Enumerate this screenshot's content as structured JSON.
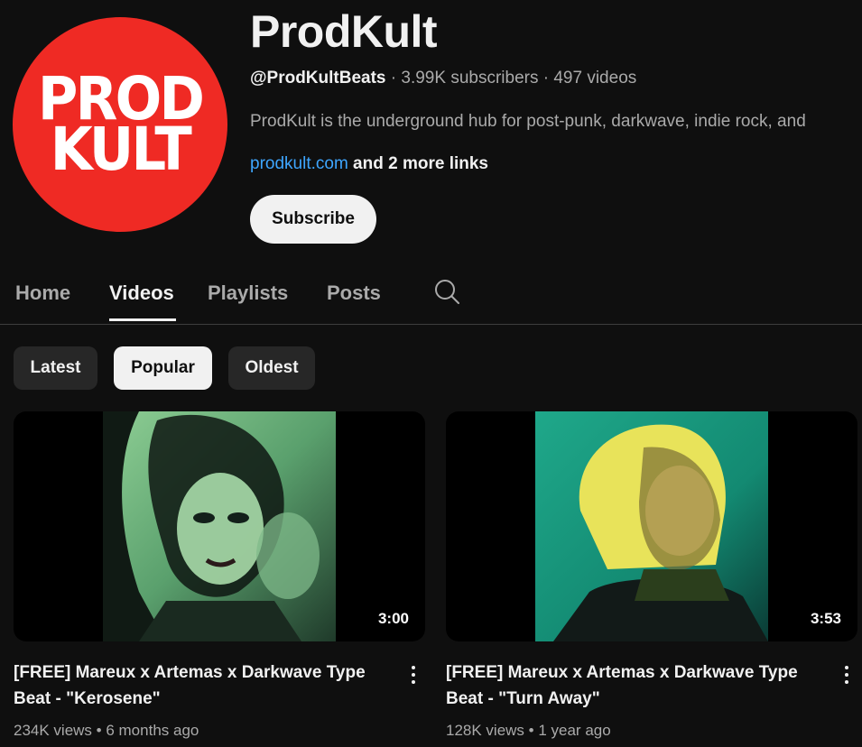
{
  "channel": {
    "logo_line1": "PROD",
    "logo_line2": "KULT",
    "logo_mark": "®",
    "name": "ProdKult",
    "handle": "@ProdKultBeats",
    "separator": " · ",
    "subscribers": "3.99K subscribers",
    "videos_count": "497 videos",
    "description": "ProdKult is the underground hub for post-punk, darkwave, indie rock, and",
    "description_more": "›",
    "link": "prodkult.com",
    "more_links": " and 2 more links",
    "subscribe_label": "Subscribe",
    "brand_color": "#ef2a24"
  },
  "tabs": [
    {
      "label": "Home",
      "active": false
    },
    {
      "label": "Videos",
      "active": true
    },
    {
      "label": "Playlists",
      "active": false
    },
    {
      "label": "Posts",
      "active": false
    }
  ],
  "search_icon": "search-icon",
  "chips": [
    {
      "label": "Latest",
      "active": false
    },
    {
      "label": "Popular",
      "active": true
    },
    {
      "label": "Oldest",
      "active": false
    }
  ],
  "videos": [
    {
      "title": "[FREE] Mareux x Artemas x Darkwave Type Beat - \"Kerosene\"",
      "duration": "3:00",
      "views": "234K views",
      "age": "6 months ago",
      "meta_sep": " • "
    },
    {
      "title": "[FREE] Mareux x Artemas x Darkwave Type Beat - \"Turn Away\"",
      "duration": "3:53",
      "views": "128K views",
      "age": "1 year ago",
      "meta_sep": " • "
    }
  ],
  "colors": {
    "background": "#0f0f0f",
    "text_primary": "#f1f1f1",
    "text_secondary": "#aaaaaa",
    "link": "#3ea6ff",
    "chip_bg": "#272727"
  }
}
